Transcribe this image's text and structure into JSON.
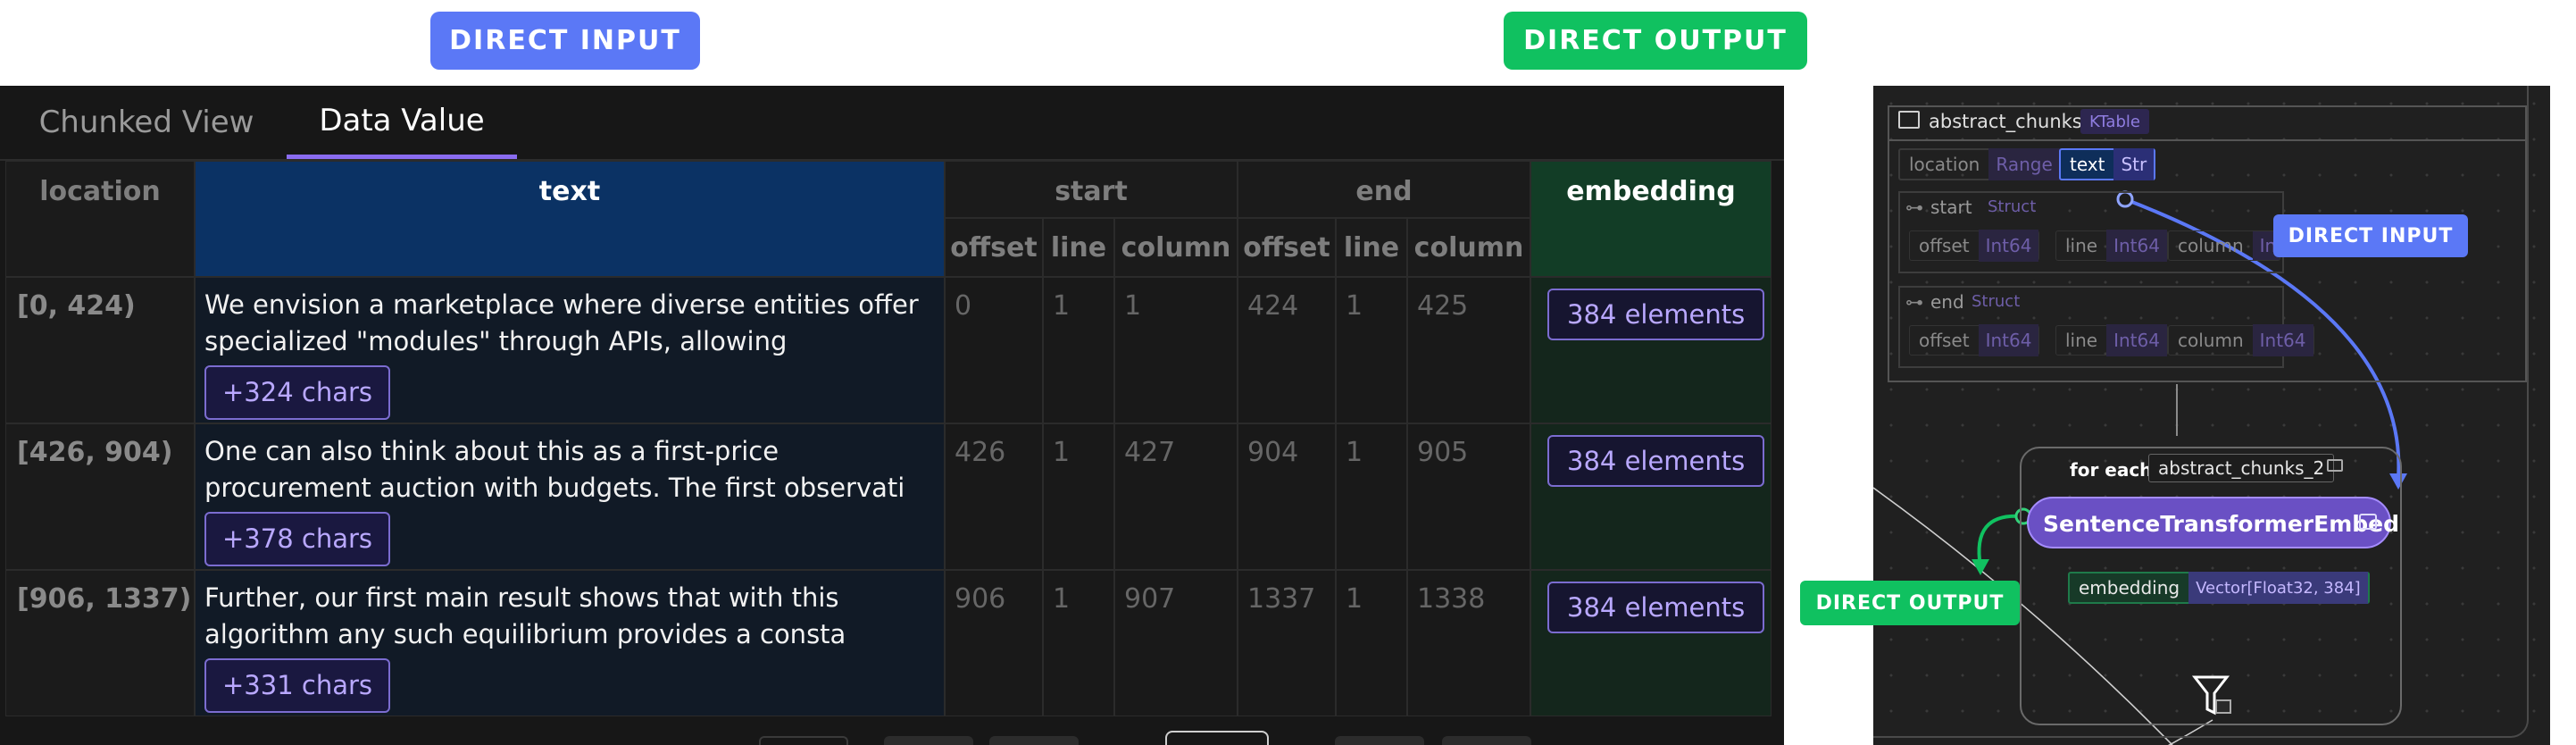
{
  "callouts": {
    "top_input": "DIRECT INPUT",
    "top_output": "DIRECT OUTPUT",
    "graph_input": "DIRECT INPUT",
    "graph_output": "DIRECT OUTPUT"
  },
  "colors": {
    "accent_blue": "#5b78f6",
    "accent_green": "#10c160",
    "accent_purple": "#7b5fd6"
  },
  "tabs": [
    {
      "label": "Chunked View",
      "active": false
    },
    {
      "label": "Data Value",
      "active": true
    }
  ],
  "table": {
    "headers": {
      "location": "location",
      "text": "text",
      "start": "start",
      "end": "end",
      "embedding": "embedding"
    },
    "subheaders": [
      "offset",
      "line",
      "column",
      "offset",
      "line",
      "column"
    ],
    "rows": [
      {
        "location": "[0, 424)",
        "text_line1": "We envision a marketplace where diverse entities offer",
        "text_line2": "specialized \"modules\" through APIs, allowing",
        "more_chars": "+324 chars",
        "start_offset": "0",
        "start_line": "1",
        "start_column": "1",
        "end_offset": "424",
        "end_line": "1",
        "end_column": "425",
        "embedding": "384 elements"
      },
      {
        "location": "[426, 904)",
        "text_line1": "One can also think about this as a first-price",
        "text_line2": "procurement auction with budgets. The first observati",
        "more_chars": "+378 chars",
        "start_offset": "426",
        "start_line": "1",
        "start_column": "427",
        "end_offset": "904",
        "end_line": "1",
        "end_column": "905",
        "embedding": "384 elements"
      },
      {
        "location": "[906, 1337)",
        "text_line1": "Further, our first main result shows that with this",
        "text_line2": "algorithm any such equilibrium provides a consta",
        "more_chars": "+331 chars",
        "start_offset": "906",
        "start_line": "1",
        "start_column": "907",
        "end_offset": "1337",
        "end_line": "1",
        "end_column": "1338",
        "embedding": "384 elements"
      }
    ]
  },
  "graph": {
    "table_node": {
      "name": "abstract_chunks",
      "type": "KTable"
    },
    "fields": {
      "location": {
        "name": "location",
        "type": "Range"
      },
      "text": {
        "name": "text",
        "type": "Str"
      },
      "start": {
        "name": "start",
        "type": "Struct"
      },
      "end": {
        "name": "end",
        "type": "Struct"
      },
      "start_offset": {
        "name": "offset",
        "type": "Int64"
      },
      "start_line": {
        "name": "line",
        "type": "Int64"
      },
      "start_column": {
        "name": "column",
        "type": "Int64"
      },
      "end_offset": {
        "name": "offset",
        "type": "Int64"
      },
      "end_line": {
        "name": "line",
        "type": "Int64"
      },
      "end_column": {
        "name": "column",
        "type": "Int64"
      }
    },
    "for_each": {
      "label": "for each",
      "target": "abstract_chunks_2"
    },
    "function_node": "SentenceTransformerEmbed",
    "output_field": {
      "name": "embedding",
      "type": "Vector[Float32, 384]"
    }
  }
}
